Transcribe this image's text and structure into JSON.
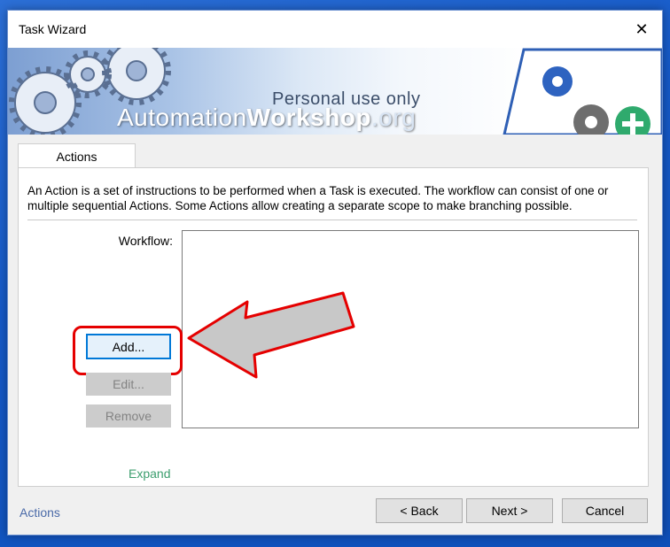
{
  "window": {
    "title": "Task Wizard",
    "close_glyph": "✕"
  },
  "banner": {
    "tagline": "Personal use only",
    "brand_part1": "Automation",
    "brand_part2": "Workshop",
    "brand_part3": ".org"
  },
  "tabs": [
    {
      "label": "Actions"
    }
  ],
  "panel": {
    "description": "An Action is a set of instructions to be performed when a Task is executed. The workflow can consist of one or multiple sequential Actions. Some Actions allow creating a separate scope to make branching possible.",
    "workflow_label": "Workflow:",
    "buttons": {
      "add": "Add...",
      "edit": "Edit...",
      "remove": "Remove"
    },
    "expand_link": "Expand"
  },
  "footer": {
    "link": "Actions",
    "back": "< Back",
    "next": "Next >",
    "cancel": "Cancel"
  },
  "colors": {
    "highlight": "#e50000",
    "link": "#4a6aa8",
    "expand": "#3c9e6e",
    "focus": "#0078d7"
  },
  "icons": {
    "gears": "gear-icon",
    "document_with_gears": "document-gears-icon",
    "add_badge": "plus-circle-icon",
    "callout_arrow": "arrow-left-icon"
  }
}
